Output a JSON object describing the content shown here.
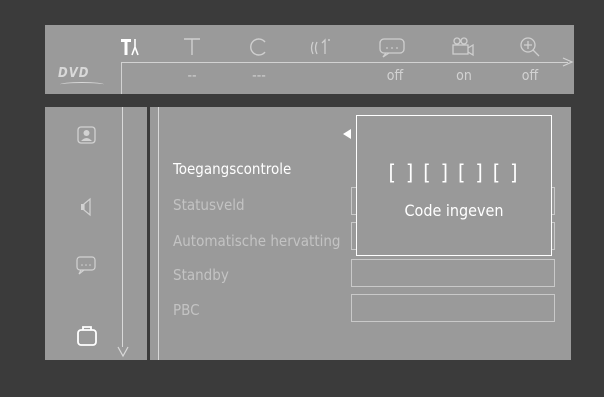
{
  "top_bar": {
    "icons": [
      {
        "name": "tools-icon",
        "glyph": "🔧"
      },
      {
        "name": "text-t-icon",
        "glyph": "T"
      },
      {
        "name": "angle-c-icon",
        "glyph": "C"
      },
      {
        "name": "audio-icon",
        "glyph": "((·"
      },
      {
        "name": "subtitle-icon",
        "glyph": "…"
      },
      {
        "name": "camera-angle-icon",
        "glyph": "🎥"
      },
      {
        "name": "zoom-icon",
        "glyph": "⊕"
      }
    ],
    "disc_label": "DVD",
    "values": [
      "--",
      "---",
      "",
      "off",
      "on",
      "off"
    ]
  },
  "left_menu": {
    "icons": [
      "picture-icon",
      "speaker-icon",
      "speech-icon",
      "briefcase-icon"
    ]
  },
  "main_menu": {
    "items": [
      {
        "label": "Toegangscontrole",
        "active": true
      },
      {
        "label": "Statusveld",
        "active": false
      },
      {
        "label": "Automatische hervatting",
        "active": false
      },
      {
        "label": "Standby",
        "active": false
      },
      {
        "label": "PBC",
        "active": false
      }
    ]
  },
  "popup": {
    "code": "[ ] [ ] [ ] [ ]",
    "prompt": "Code ingeven"
  },
  "colors": {
    "background": "#3b3b3b",
    "panel": "#9a9a9a",
    "text_active": "#ffffff",
    "text_inactive": "#c3c3c3"
  }
}
